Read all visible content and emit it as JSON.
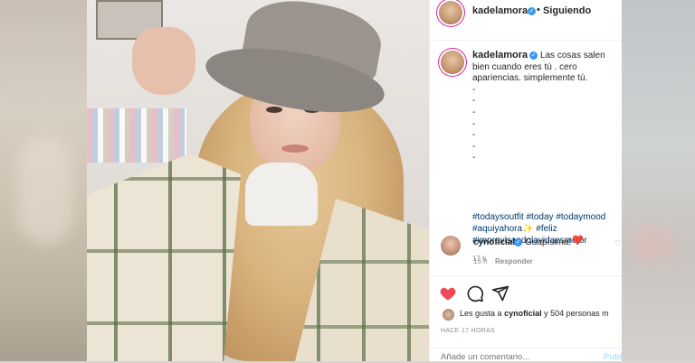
{
  "post": {
    "username": "kadelamora",
    "separator": "•",
    "follow_status": "Siguiendo",
    "caption_lead": "Las cosas salen bien cuando eres tú . cero apariencias. simplemente tú.",
    "caption_dashes": "-\n-\n-\n-\n-\n-\n-",
    "hashtags": [
      {
        "text": "#todaysoutfit"
      },
      {
        "text": "#today"
      },
      {
        "text": "#todaymood"
      },
      {
        "text": "#aquiyahora"
      },
      {
        "text": "✨"
      },
      {
        "text": "#feliz"
      },
      {
        "text": "#improvisandolavidaesmejor"
      }
    ],
    "caption_time": "17 h"
  },
  "comment": {
    "username": "cynoficial",
    "text": "Guapísima!",
    "emoji": "❤️",
    "time": "16 h",
    "reply_label": "Responder"
  },
  "likes": {
    "prefix": "Les gusta a",
    "user": "cynoficial",
    "suffix": "y 504 personas m"
  },
  "timestamp": "HACE 17 HORAS",
  "add_comment": {
    "placeholder": "Añade un comentario...",
    "publish_label": "Publ"
  },
  "icons": {
    "verified": "verified-badge-icon",
    "like": "heart-filled-icon",
    "comment": "comment-bubble-icon",
    "share": "paper-plane-icon"
  },
  "colors": {
    "like_red": "#ed4956",
    "verified_blue": "#3897f0",
    "hashtag": "#00376b",
    "muted": "#8e8e8e"
  }
}
